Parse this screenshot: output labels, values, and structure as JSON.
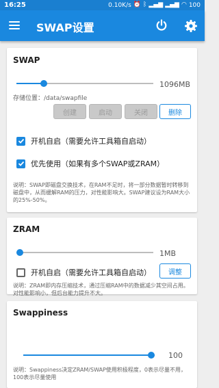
{
  "status_bar": {
    "time": "16:25",
    "speed": "0.10K/s",
    "battery": "100"
  },
  "toolbar": {
    "title": "SWAP设置"
  },
  "swap": {
    "title": "SWAP",
    "size_value": "1096MB",
    "slider_fraction": 0.2,
    "path_text": "存储位置：/data/swapfile",
    "buttons": {
      "create": "创建",
      "start": "启动",
      "close": "关闭",
      "delete": "删除"
    },
    "autostart_label": "开机自启（需要允许工具箱自启动）",
    "autostart_checked": true,
    "priority_label": "优先使用（如果有多个SWAP或ZRAM）",
    "priority_checked": true,
    "note": "说明：SWAP即磁盘交换技术，在RAM不足时，将一部分数据暂时转移到磁盘中，从而缓解RAM的压力，对性能影响大。SWAP建议设为RAM大小的25%-50%。"
  },
  "zram": {
    "title": "ZRAM",
    "size_value": "1MB",
    "slider_fraction": 0.0,
    "autostart_label": "开机自启（需要允许工具箱自启动）",
    "autostart_checked": false,
    "adjust_label": "调整",
    "note": "说明：ZRAM即内存压缩技术，通过压缩RAM中的数据减少其空间占用。对性能影响小，但后台能力提升不大。"
  },
  "swappiness": {
    "title": "Swappiness",
    "value": "100",
    "slider_fraction": 1.0,
    "note": "说明：Swappiness决定ZRAM/SWAP使用积极程度，0表示尽量不用，100表示尽量使用"
  },
  "colors": {
    "accent": "#1a88df",
    "status_bar": "#1a7fd0"
  }
}
